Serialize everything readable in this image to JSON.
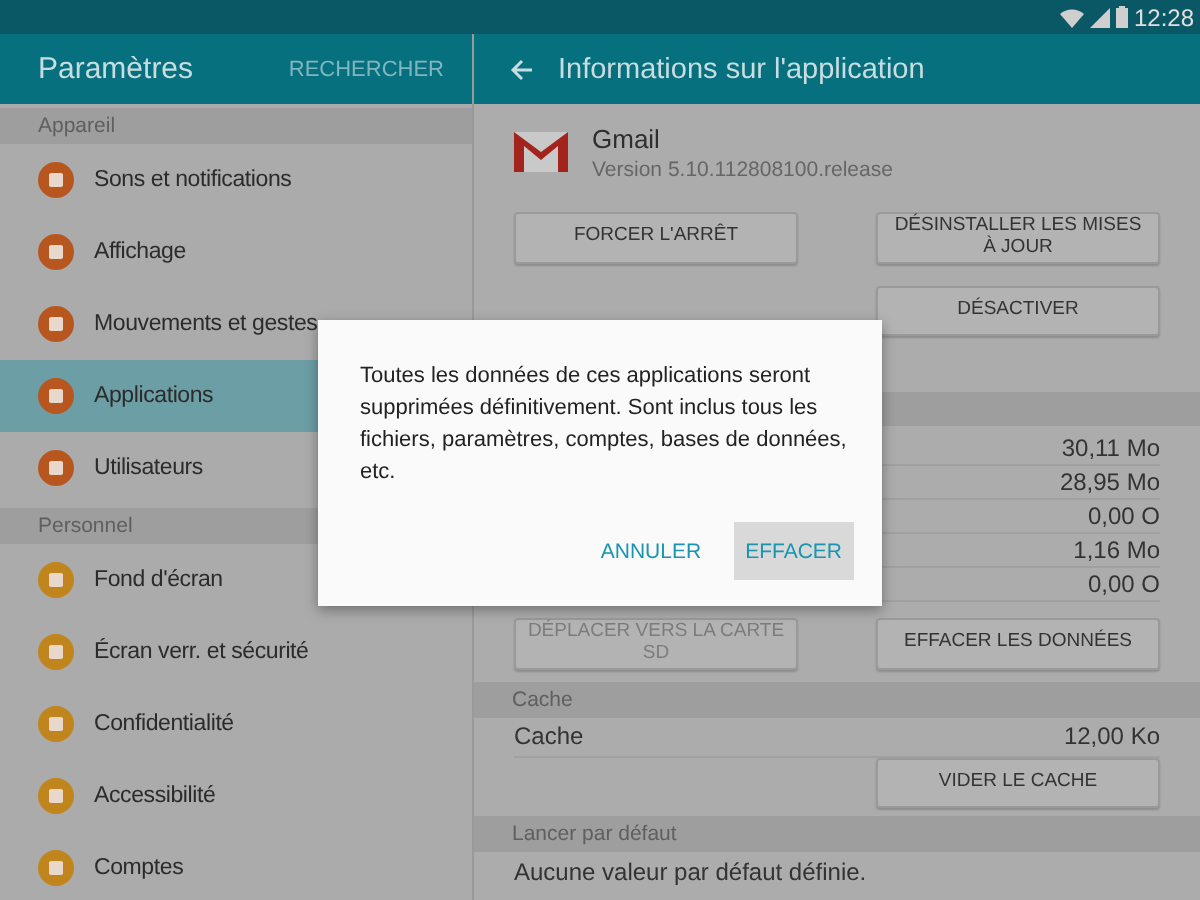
{
  "status_bar": {
    "time": "12:28"
  },
  "sidebar": {
    "title": "Paramètres",
    "search": "RECHERCHER",
    "sections": [
      {
        "header": "Appareil",
        "items": [
          {
            "label": "Sons et notifications",
            "color": "#b8561f",
            "selected": false
          },
          {
            "label": "Affichage",
            "color": "#b8561f",
            "selected": false
          },
          {
            "label": "Mouvements et gestes",
            "color": "#b8561f",
            "selected": false
          },
          {
            "label": "Applications",
            "color": "#b8561f",
            "selected": true
          },
          {
            "label": "Utilisateurs",
            "color": "#b8561f",
            "selected": false
          }
        ]
      },
      {
        "header": "Personnel",
        "items": [
          {
            "label": "Fond d'écran",
            "color": "#c0851d",
            "selected": false
          },
          {
            "label": "Écran verr. et sécurité",
            "color": "#c0851d",
            "selected": false
          },
          {
            "label": "Confidentialité",
            "color": "#c0851d",
            "selected": false
          },
          {
            "label": "Accessibilité",
            "color": "#c0851d",
            "selected": false
          },
          {
            "label": "Comptes",
            "color": "#c0851d",
            "selected": false
          }
        ]
      }
    ]
  },
  "detail": {
    "title": "Informations sur l'application",
    "app": {
      "name": "Gmail",
      "version": "Version 5.10.112808100.release"
    },
    "buttons_top": [
      {
        "label": "FORCER L'ARRÊT",
        "disabled": false
      },
      {
        "label": "DÉSINSTALLER LES MISES À JOUR",
        "disabled": false
      },
      {
        "label": "DÉSACTIVER",
        "disabled": false
      }
    ],
    "storage_values": [
      "30,11 Mo",
      "28,95 Mo",
      "0,00 O",
      "1,16 Mo",
      "0,00 O"
    ],
    "storage_buttons": [
      {
        "label": "DÉPLACER VERS LA CARTE SD",
        "disabled": true
      },
      {
        "label": "EFFACER LES DONNÉES",
        "disabled": false
      }
    ],
    "cache": {
      "header": "Cache",
      "label": "Cache",
      "value": "12,00 Ko",
      "button": {
        "label": "VIDER LE CACHE",
        "disabled": false
      }
    },
    "defaults": {
      "header": "Lancer par défaut",
      "text": "Aucune valeur par défaut définie."
    }
  },
  "dialog": {
    "message": "Toutes les données de ces applications seront supprimées définitivement. Sont inclus tous les fichiers, paramètres, comptes, bases de données, etc.",
    "buttons": [
      {
        "label": "ANNULER",
        "selected": false
      },
      {
        "label": "EFFACER",
        "selected": true
      }
    ]
  }
}
